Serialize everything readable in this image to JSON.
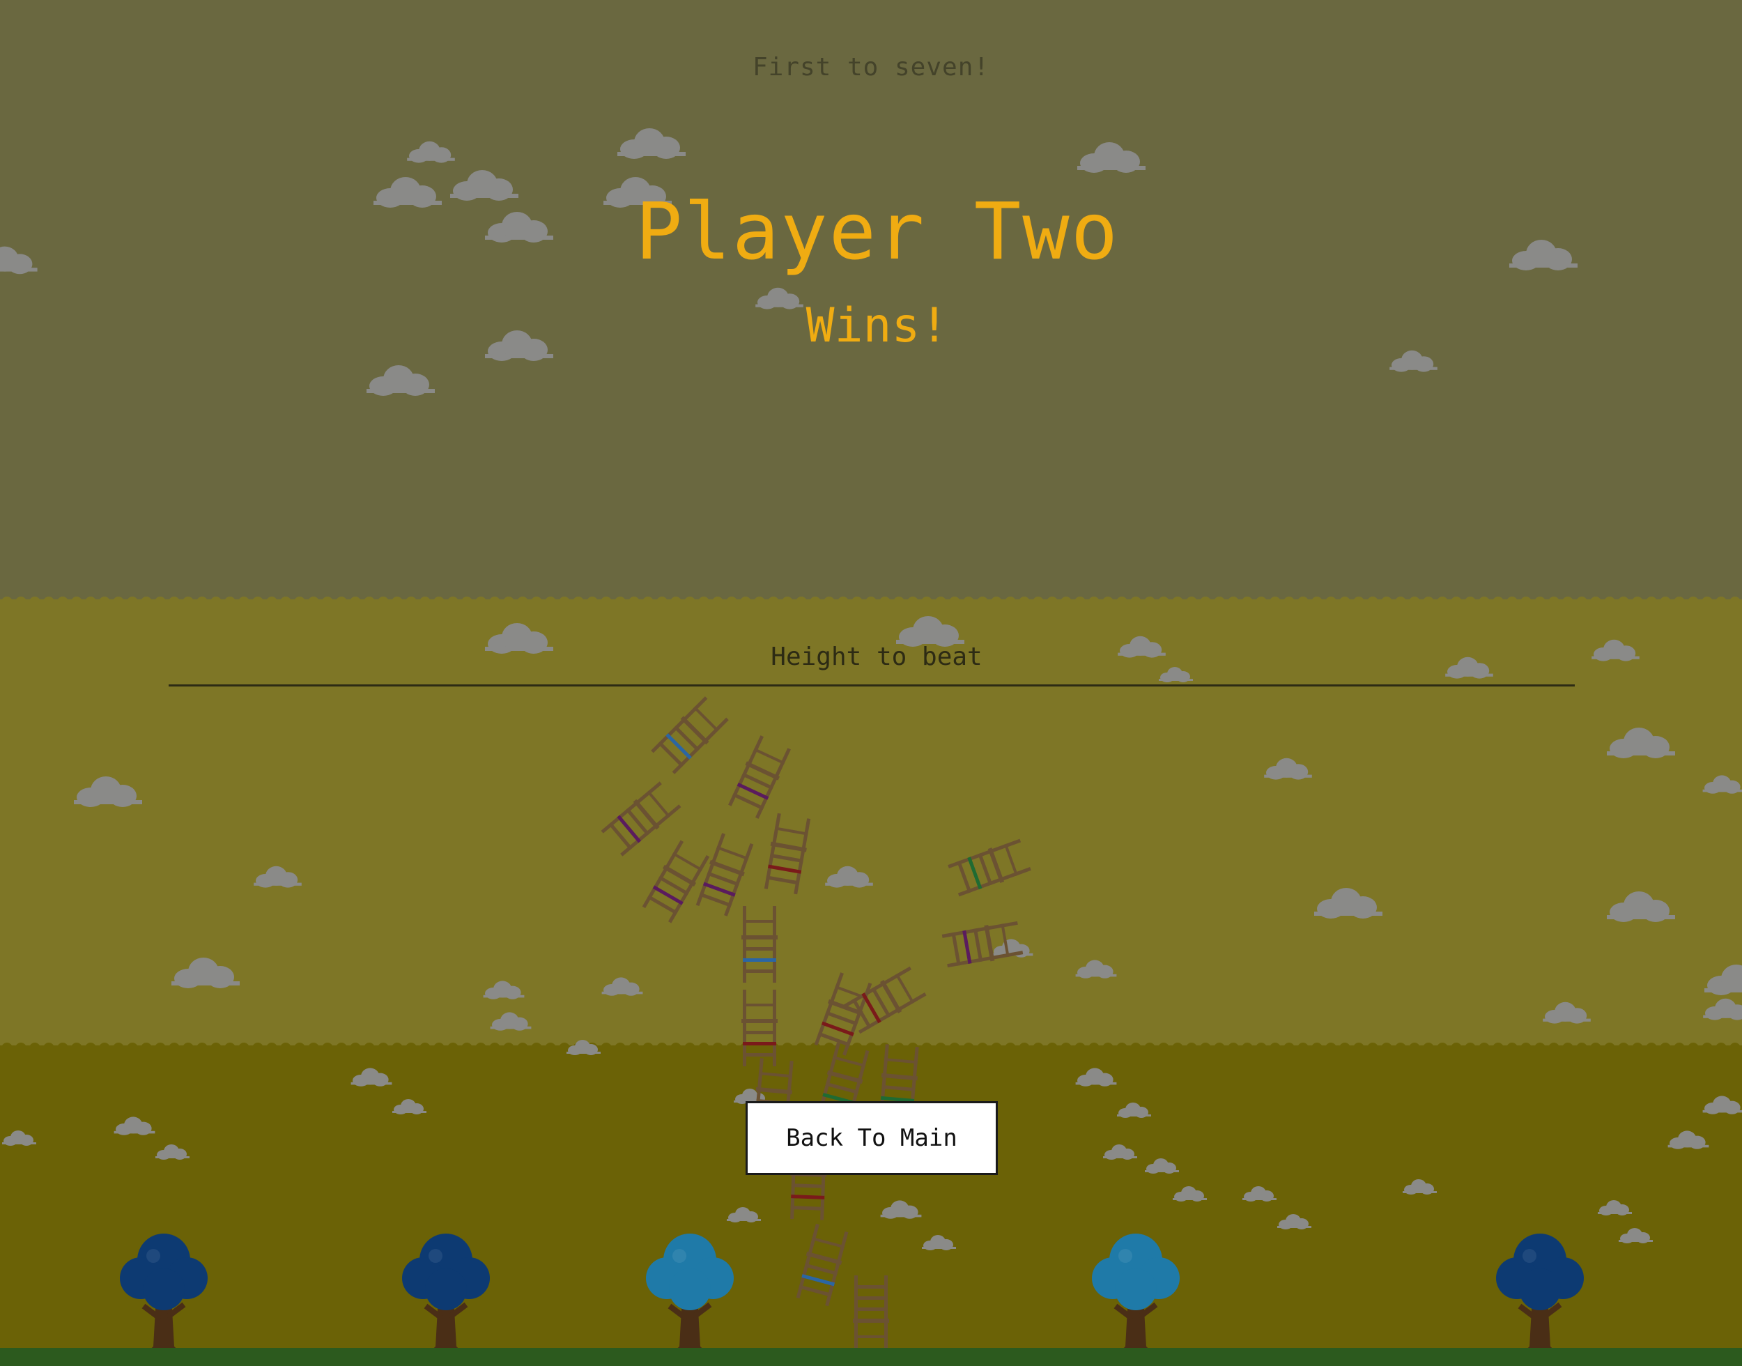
{
  "game": {
    "subtitle": "First to seven!",
    "winner_name": "Player Two",
    "winner_suffix": "Wins!",
    "height_label": "Height to beat",
    "back_button_label": "Back To Main"
  },
  "colors": {
    "sky_top": "#6a6840",
    "sky_mid": "#7e7626",
    "sky_low": "#6b6206",
    "title_text": "#f0ac12",
    "label_text": "#2d2b14",
    "cloud": "#8a8a88",
    "chair_wood": "#6b5232",
    "grass": "#2c5a1e",
    "tree_dark": "#0d3a72",
    "tree_light": "#1f7aa8",
    "trunk": "#4a2e16"
  },
  "scene": {
    "tree_icons": [
      "tree-dark-icon",
      "tree-dark-icon",
      "tree-light-icon",
      "tree-light-icon",
      "tree-dark-icon"
    ],
    "chair_stripe_colors": [
      "#2b66a3",
      "#5a1b5e",
      "#5a1b5e",
      "#7a1a1a",
      "#5a1b5e",
      "#5a1b5e",
      "#2b66a3",
      "#1f6b32",
      "#5a1b5e",
      "#7a1a1a",
      "#7a1a1a",
      "#7a1a1a",
      "#7a1a1a",
      "#1f6b32",
      "#1f6b32",
      "#7a1a1a",
      "#2b66a3",
      "#6b5232"
    ]
  }
}
